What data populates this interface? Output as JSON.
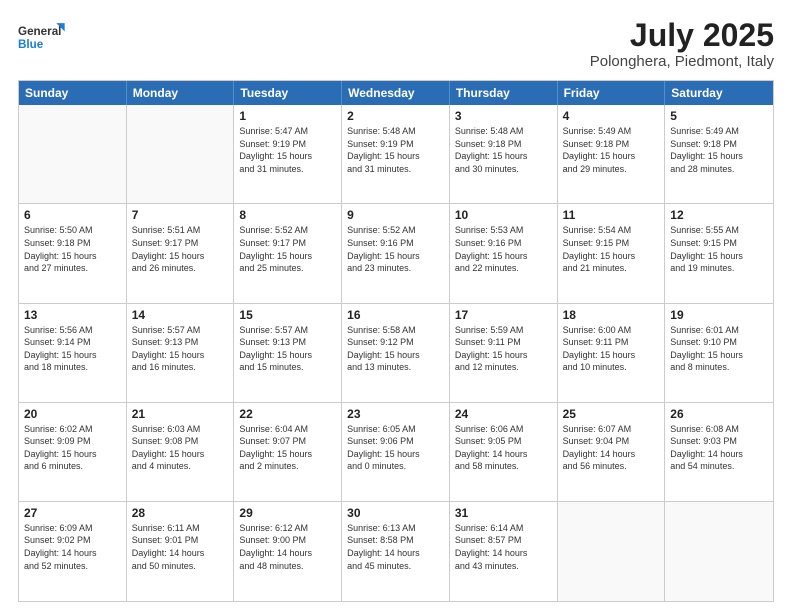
{
  "logo": {
    "line1": "General",
    "line2": "Blue"
  },
  "title": "July 2025",
  "subtitle": "Polonghera, Piedmont, Italy",
  "header_days": [
    "Sunday",
    "Monday",
    "Tuesday",
    "Wednesday",
    "Thursday",
    "Friday",
    "Saturday"
  ],
  "weeks": [
    [
      {
        "day": "",
        "details": ""
      },
      {
        "day": "",
        "details": ""
      },
      {
        "day": "1",
        "details": "Sunrise: 5:47 AM\nSunset: 9:19 PM\nDaylight: 15 hours\nand 31 minutes."
      },
      {
        "day": "2",
        "details": "Sunrise: 5:48 AM\nSunset: 9:19 PM\nDaylight: 15 hours\nand 31 minutes."
      },
      {
        "day": "3",
        "details": "Sunrise: 5:48 AM\nSunset: 9:18 PM\nDaylight: 15 hours\nand 30 minutes."
      },
      {
        "day": "4",
        "details": "Sunrise: 5:49 AM\nSunset: 9:18 PM\nDaylight: 15 hours\nand 29 minutes."
      },
      {
        "day": "5",
        "details": "Sunrise: 5:49 AM\nSunset: 9:18 PM\nDaylight: 15 hours\nand 28 minutes."
      }
    ],
    [
      {
        "day": "6",
        "details": "Sunrise: 5:50 AM\nSunset: 9:18 PM\nDaylight: 15 hours\nand 27 minutes."
      },
      {
        "day": "7",
        "details": "Sunrise: 5:51 AM\nSunset: 9:17 PM\nDaylight: 15 hours\nand 26 minutes."
      },
      {
        "day": "8",
        "details": "Sunrise: 5:52 AM\nSunset: 9:17 PM\nDaylight: 15 hours\nand 25 minutes."
      },
      {
        "day": "9",
        "details": "Sunrise: 5:52 AM\nSunset: 9:16 PM\nDaylight: 15 hours\nand 23 minutes."
      },
      {
        "day": "10",
        "details": "Sunrise: 5:53 AM\nSunset: 9:16 PM\nDaylight: 15 hours\nand 22 minutes."
      },
      {
        "day": "11",
        "details": "Sunrise: 5:54 AM\nSunset: 9:15 PM\nDaylight: 15 hours\nand 21 minutes."
      },
      {
        "day": "12",
        "details": "Sunrise: 5:55 AM\nSunset: 9:15 PM\nDaylight: 15 hours\nand 19 minutes."
      }
    ],
    [
      {
        "day": "13",
        "details": "Sunrise: 5:56 AM\nSunset: 9:14 PM\nDaylight: 15 hours\nand 18 minutes."
      },
      {
        "day": "14",
        "details": "Sunrise: 5:57 AM\nSunset: 9:13 PM\nDaylight: 15 hours\nand 16 minutes."
      },
      {
        "day": "15",
        "details": "Sunrise: 5:57 AM\nSunset: 9:13 PM\nDaylight: 15 hours\nand 15 minutes."
      },
      {
        "day": "16",
        "details": "Sunrise: 5:58 AM\nSunset: 9:12 PM\nDaylight: 15 hours\nand 13 minutes."
      },
      {
        "day": "17",
        "details": "Sunrise: 5:59 AM\nSunset: 9:11 PM\nDaylight: 15 hours\nand 12 minutes."
      },
      {
        "day": "18",
        "details": "Sunrise: 6:00 AM\nSunset: 9:11 PM\nDaylight: 15 hours\nand 10 minutes."
      },
      {
        "day": "19",
        "details": "Sunrise: 6:01 AM\nSunset: 9:10 PM\nDaylight: 15 hours\nand 8 minutes."
      }
    ],
    [
      {
        "day": "20",
        "details": "Sunrise: 6:02 AM\nSunset: 9:09 PM\nDaylight: 15 hours\nand 6 minutes."
      },
      {
        "day": "21",
        "details": "Sunrise: 6:03 AM\nSunset: 9:08 PM\nDaylight: 15 hours\nand 4 minutes."
      },
      {
        "day": "22",
        "details": "Sunrise: 6:04 AM\nSunset: 9:07 PM\nDaylight: 15 hours\nand 2 minutes."
      },
      {
        "day": "23",
        "details": "Sunrise: 6:05 AM\nSunset: 9:06 PM\nDaylight: 15 hours\nand 0 minutes."
      },
      {
        "day": "24",
        "details": "Sunrise: 6:06 AM\nSunset: 9:05 PM\nDaylight: 14 hours\nand 58 minutes."
      },
      {
        "day": "25",
        "details": "Sunrise: 6:07 AM\nSunset: 9:04 PM\nDaylight: 14 hours\nand 56 minutes."
      },
      {
        "day": "26",
        "details": "Sunrise: 6:08 AM\nSunset: 9:03 PM\nDaylight: 14 hours\nand 54 minutes."
      }
    ],
    [
      {
        "day": "27",
        "details": "Sunrise: 6:09 AM\nSunset: 9:02 PM\nDaylight: 14 hours\nand 52 minutes."
      },
      {
        "day": "28",
        "details": "Sunrise: 6:11 AM\nSunset: 9:01 PM\nDaylight: 14 hours\nand 50 minutes."
      },
      {
        "day": "29",
        "details": "Sunrise: 6:12 AM\nSunset: 9:00 PM\nDaylight: 14 hours\nand 48 minutes."
      },
      {
        "day": "30",
        "details": "Sunrise: 6:13 AM\nSunset: 8:58 PM\nDaylight: 14 hours\nand 45 minutes."
      },
      {
        "day": "31",
        "details": "Sunrise: 6:14 AM\nSunset: 8:57 PM\nDaylight: 14 hours\nand 43 minutes."
      },
      {
        "day": "",
        "details": ""
      },
      {
        "day": "",
        "details": ""
      }
    ]
  ]
}
